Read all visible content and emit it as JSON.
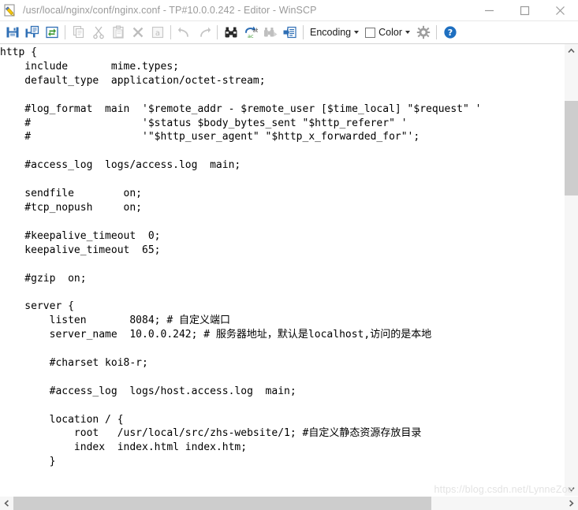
{
  "window": {
    "title": "/usr/local/nginx/conf/nginx.conf - TP#10.0.0.242 - Editor - WinSCP",
    "app_icon": "editor-pencil-icon",
    "controls": {
      "minimize": "Minimize",
      "maximize": "Maximize",
      "close": "Close"
    }
  },
  "toolbar": {
    "buttons": [
      {
        "name": "save",
        "label": "Save",
        "icon": "save-icon",
        "enabled": true
      },
      {
        "name": "save-as",
        "label": "Save As",
        "icon": "save-as-icon",
        "enabled": true
      },
      {
        "name": "reload",
        "label": "Reload",
        "icon": "reload-icon",
        "enabled": true
      },
      {
        "name": "copy",
        "label": "Copy",
        "icon": "copy-icon",
        "enabled": false
      },
      {
        "name": "cut",
        "label": "Cut",
        "icon": "scissors-icon",
        "enabled": false
      },
      {
        "name": "paste",
        "label": "Paste",
        "icon": "clipboard-icon",
        "enabled": false
      },
      {
        "name": "delete",
        "label": "Delete",
        "icon": "x-icon",
        "enabled": false
      },
      {
        "name": "select-all",
        "label": "Select All",
        "icon": "select-all-icon",
        "enabled": false
      },
      {
        "name": "undo",
        "label": "Undo",
        "icon": "undo-arrow-icon",
        "enabled": false
      },
      {
        "name": "redo",
        "label": "Redo",
        "icon": "redo-arrow-icon",
        "enabled": false
      },
      {
        "name": "find",
        "label": "Find",
        "icon": "binoculars-icon",
        "enabled": true
      },
      {
        "name": "replace",
        "label": "Replace",
        "icon": "replace-abac-icon",
        "enabled": true
      },
      {
        "name": "find-next",
        "label": "Find Next",
        "icon": "binoculars-next-icon",
        "enabled": false
      },
      {
        "name": "go-to-line",
        "label": "Go To Line",
        "icon": "goto-line-icon",
        "enabled": true
      }
    ],
    "encoding_label": "Encoding",
    "color_label": "Color",
    "settings_label": "Preferences",
    "help_label": "Help"
  },
  "editor": {
    "content": "http {\n    include       mime.types;\n    default_type  application/octet-stream;\n\n    #log_format  main  '$remote_addr - $remote_user [$time_local] \"$request\" '\n    #                  '$status $body_bytes_sent \"$http_referer\" '\n    #                  '\"$http_user_agent\" \"$http_x_forwarded_for\"';\n\n    #access_log  logs/access.log  main;\n\n    sendfile        on;\n    #tcp_nopush     on;\n\n    #keepalive_timeout  0;\n    keepalive_timeout  65;\n\n    #gzip  on;\n\n    server {\n        listen       8084; # 自定义端口\n        server_name  10.0.0.242; # 服务器地址，默认是localhost,访问的是本地\n\n        #charset koi8-r;\n\n        #access_log  logs/host.access.log  main;\n\n        location / {\n            root   /usr/local/src/zhs-website/1; #自定义静态资源存放目录\n            index  index.html index.htm;\n        }"
  },
  "scrollbars": {
    "vertical": {
      "up_arrow": "scroll-up",
      "down_arrow": "scroll-down",
      "thumb": "vertical-thumb"
    },
    "horizontal": {
      "left_arrow": "scroll-left",
      "right_arrow": "scroll-right",
      "thumb": "horizontal-thumb"
    }
  },
  "watermark": {
    "text": "https://blog.csdn.net/LynneZoe"
  },
  "colors": {
    "accent": "#1e6fc0",
    "toolbar_icon_green": "#3f9b35",
    "disabled_gray": "#c0c0c0",
    "scrollbar_thumb": "#cdcdcd",
    "title_text": "#9a9a9a"
  }
}
